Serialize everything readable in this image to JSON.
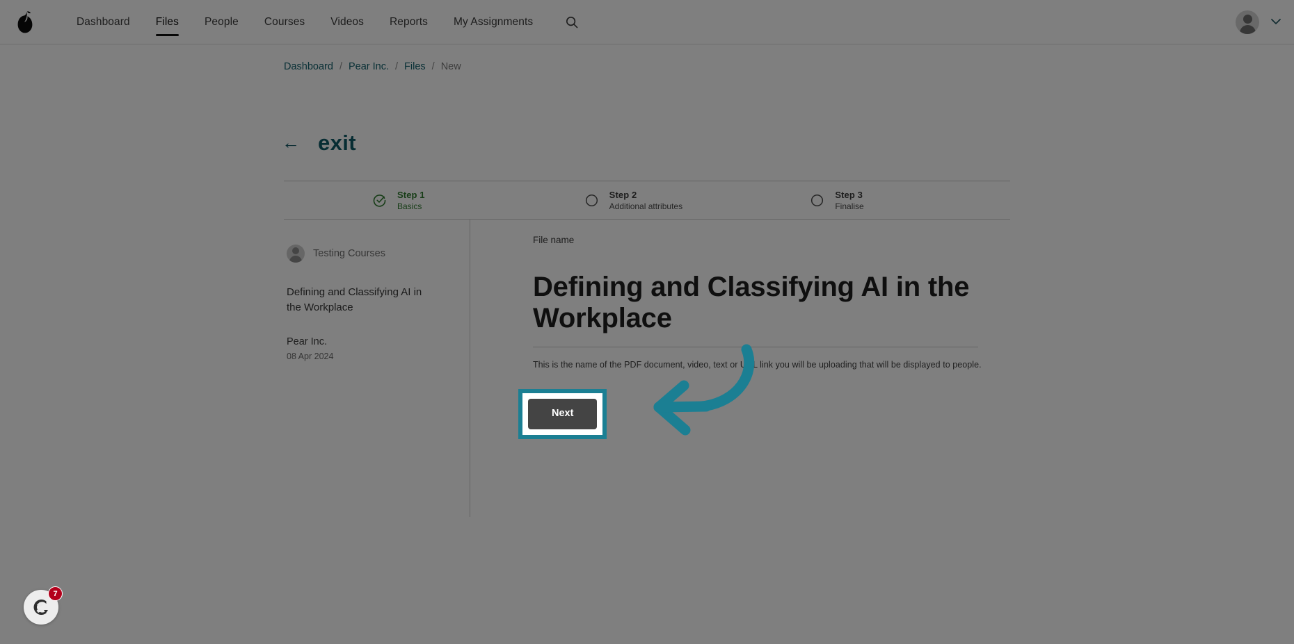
{
  "topnav": {
    "logo_icon": "pear-logo-icon",
    "items": [
      {
        "label": "Dashboard",
        "active": false
      },
      {
        "label": "Files",
        "active": true
      },
      {
        "label": "People",
        "active": false
      },
      {
        "label": "Courses",
        "active": false
      },
      {
        "label": "Videos",
        "active": false
      },
      {
        "label": "Reports",
        "active": false
      },
      {
        "label": "My Assignments",
        "active": false
      }
    ],
    "search_icon": "search-icon",
    "avatar_icon": "avatar-icon",
    "chevron_icon": "chevron-down-icon"
  },
  "breadcrumb": {
    "items": [
      "Dashboard",
      "Pear Inc.",
      "Files",
      "New"
    ],
    "separator": "/"
  },
  "exit": {
    "arrow": "←",
    "label": "exit"
  },
  "stepper": {
    "steps": [
      {
        "title": "Step 1",
        "subtitle": "Basics",
        "state": "done"
      },
      {
        "title": "Step 2",
        "subtitle": "Additional attributes",
        "state": "todo"
      },
      {
        "title": "Step 3",
        "subtitle": "Finalise",
        "state": "todo"
      }
    ]
  },
  "side_panel": {
    "owner_name": "Testing Courses",
    "item_title": "Defining and Classifying AI in the Workplace",
    "organisation": "Pear Inc.",
    "date": "08 Apr 2024"
  },
  "main_panel": {
    "field_label": "File name",
    "file_name_value": "Defining and Classifying AI in the Workplace",
    "file_name_placeholder": "File name",
    "help_text": "This is the name of the PDF document, video, text or URL link you will be uploading that will be displayed to people."
  },
  "actions": {
    "next_label": "Next"
  },
  "chat_widget": {
    "badge_count": "7",
    "icon": "chat-logo-icon"
  },
  "colors": {
    "accent_teal": "#1b7f93",
    "link_teal": "#12606c",
    "step_done_green": "#2f7a2f",
    "button_dark": "#444444",
    "badge_red": "#b3001b"
  }
}
